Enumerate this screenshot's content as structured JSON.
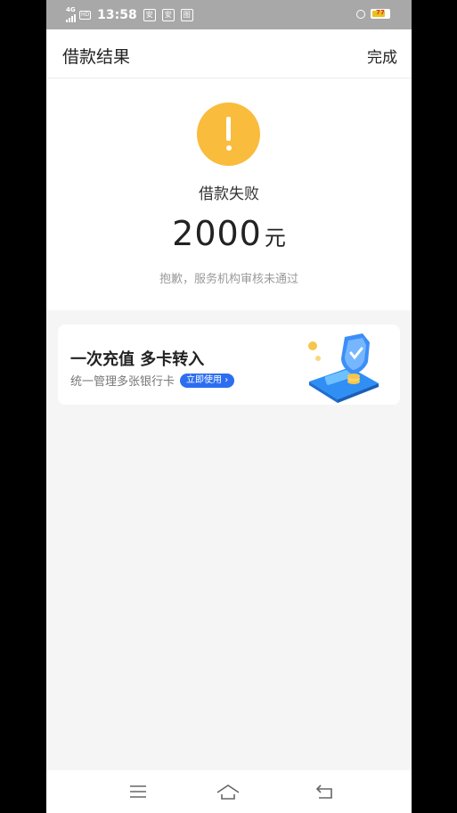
{
  "statusbar": {
    "network": "4G",
    "hd": "HD",
    "time": "13:58",
    "app_icons": [
      "安",
      "安",
      "图"
    ],
    "battery": "77"
  },
  "header": {
    "title": "借款结果",
    "done_label": "完成"
  },
  "result": {
    "status": "借款失败",
    "amount": "2000",
    "unit": "元",
    "reason": "抱歉，服务机构审核未通过"
  },
  "promo": {
    "title": "一次充值 多卡转入",
    "subtitle": "统一管理多张银行卡",
    "cta": "立即使用 ›"
  },
  "colors": {
    "warning": "#f9bc3c",
    "accent": "#2d6ef0",
    "page_bg": "#f5f5f5"
  },
  "icons": {
    "warning": "exclamation-icon",
    "nav_menu": "menu-icon",
    "nav_home": "home-icon",
    "nav_back": "back-icon"
  }
}
